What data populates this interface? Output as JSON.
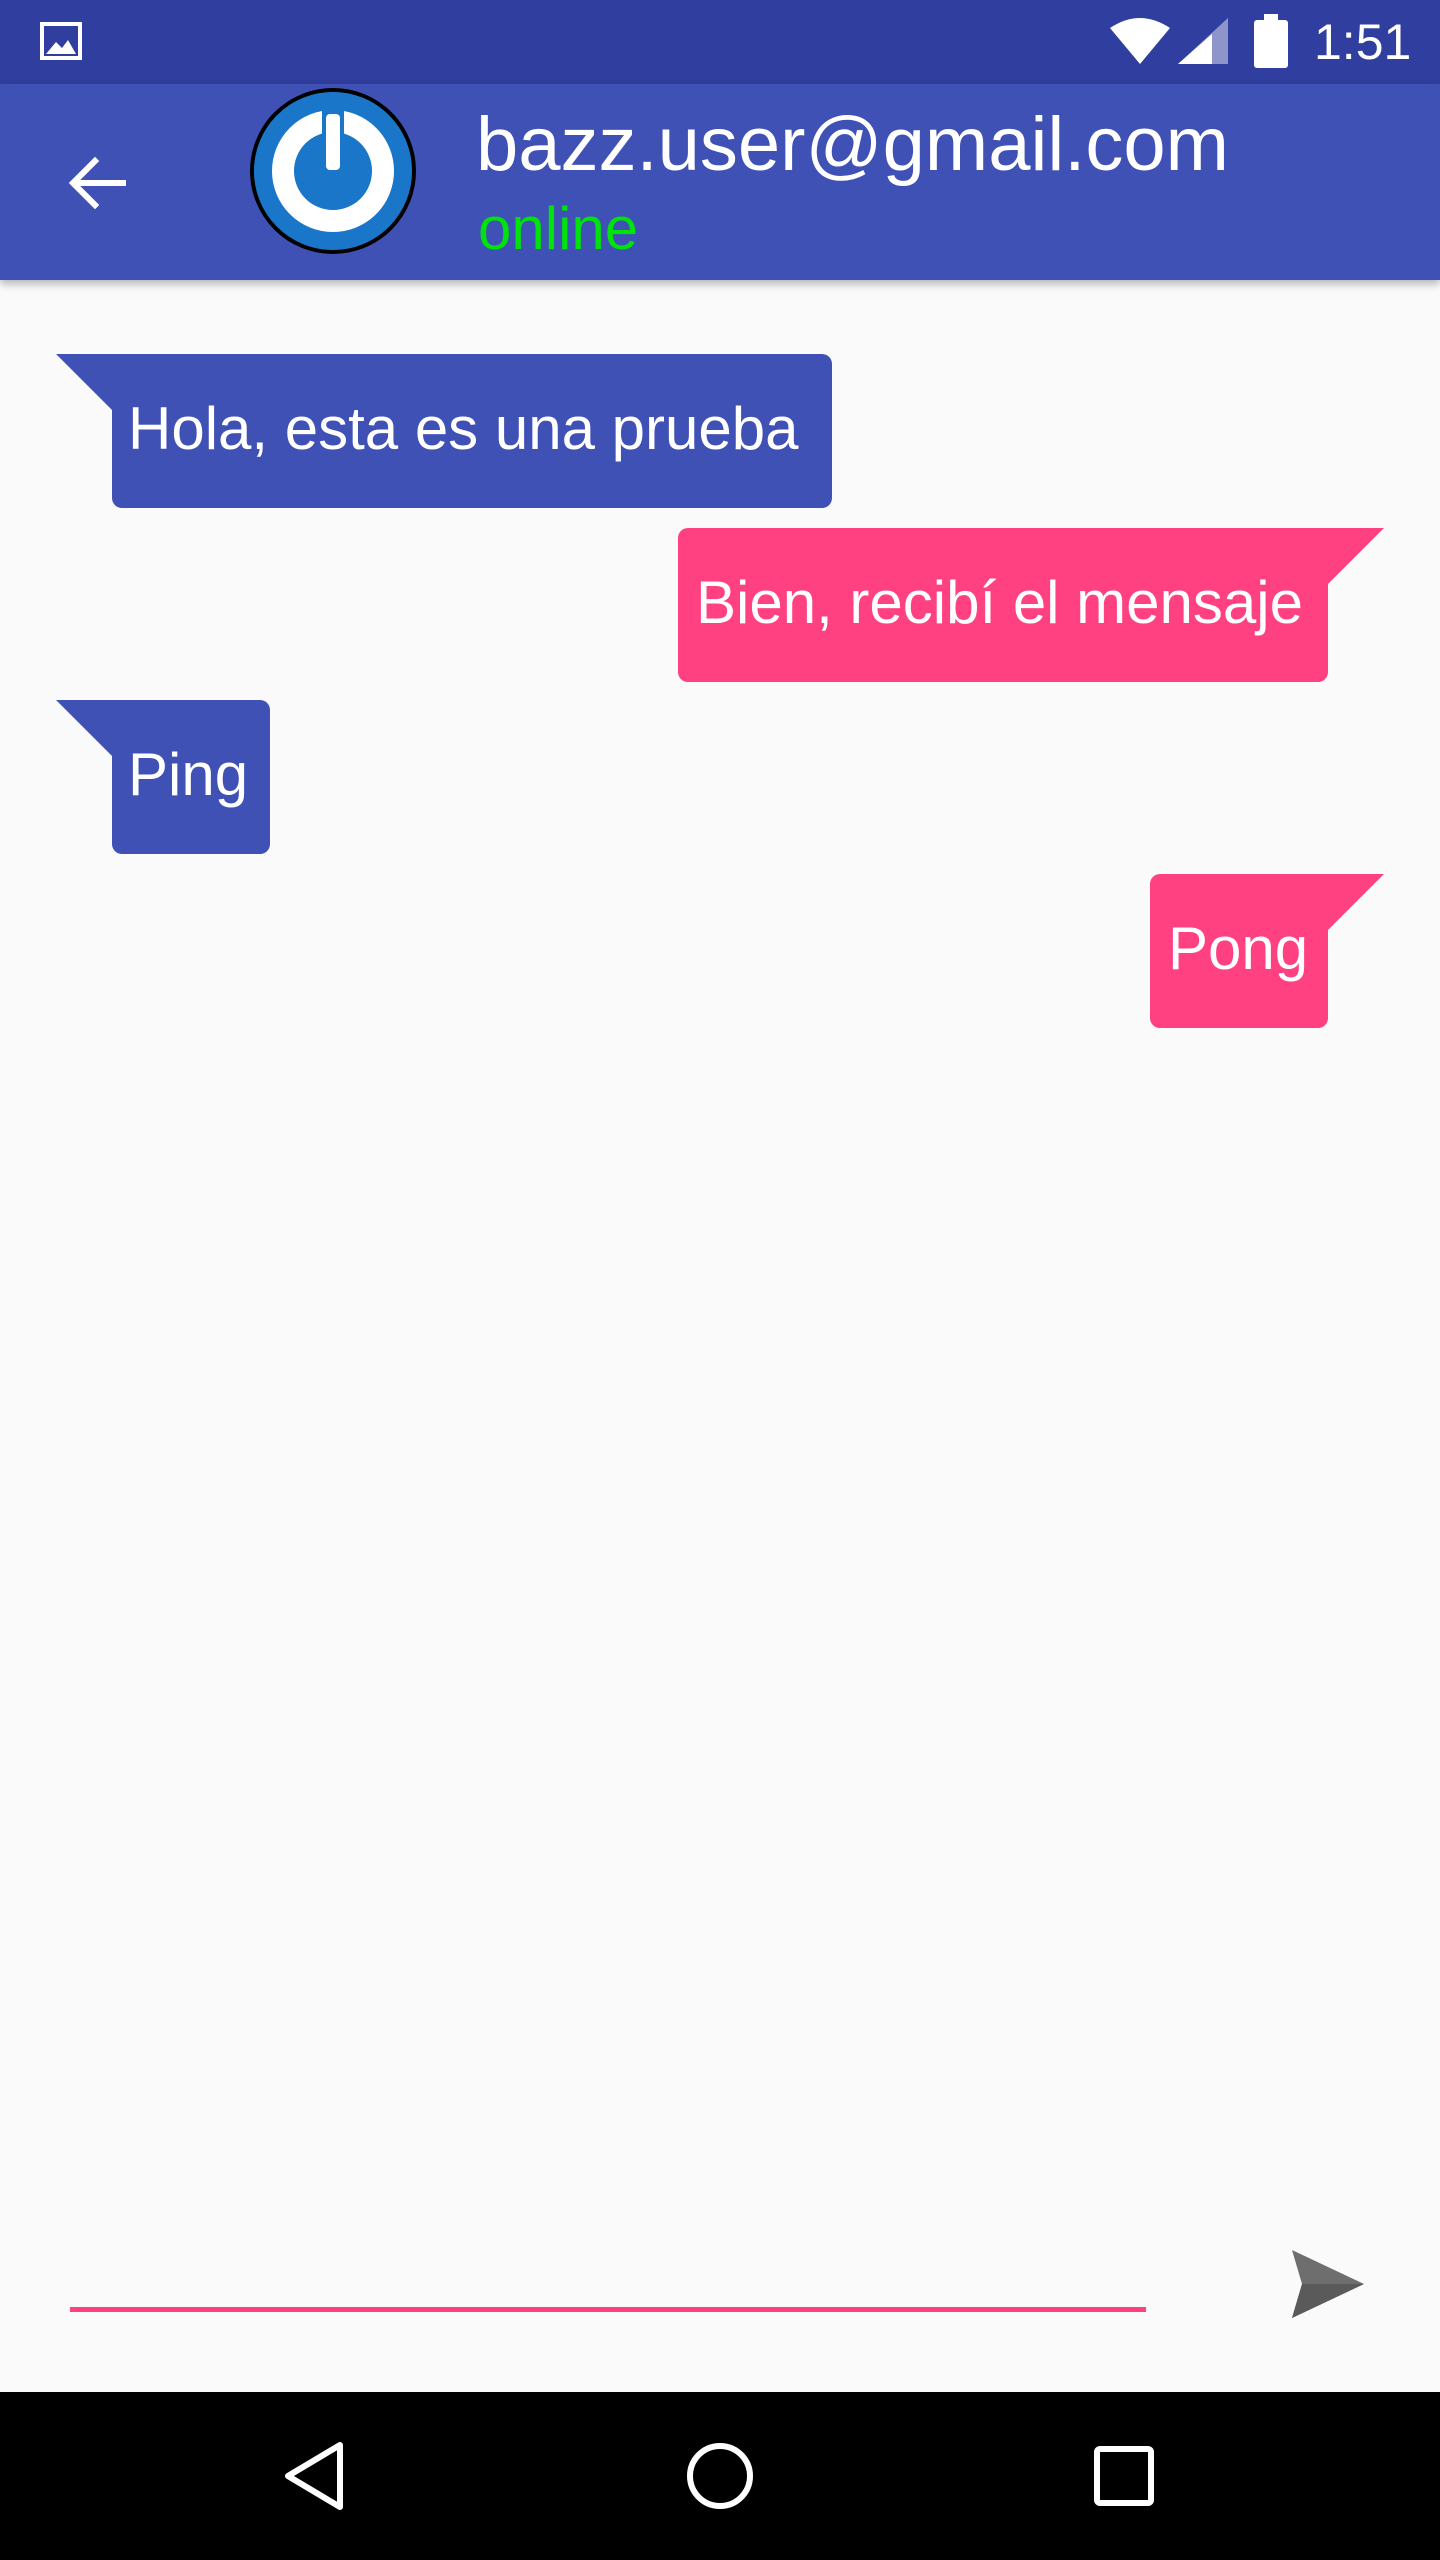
{
  "status_bar": {
    "time": "1:51",
    "icons": [
      "gallery-icon",
      "wifi-icon",
      "signal-icon",
      "battery-icon"
    ]
  },
  "header": {
    "contact_name": "bazz.user@gmail.com",
    "status": "online",
    "colors": {
      "bar": "#3f51b5",
      "status_bar": "#303f9f",
      "online": "#00e20c"
    },
    "icons": {
      "back": "arrow-left-icon",
      "avatar": "power-icon"
    }
  },
  "messages": [
    {
      "text": "Hola, esta es una prueba",
      "direction": "incoming"
    },
    {
      "text": "Bien, recibí el mensaje",
      "direction": "outgoing"
    },
    {
      "text": "Ping",
      "direction": "incoming"
    },
    {
      "text": "Pong",
      "direction": "outgoing"
    }
  ],
  "bubble_colors": {
    "incoming": "#3f51b5",
    "outgoing": "#ff4081"
  },
  "composer": {
    "value": "",
    "placeholder": "",
    "send_icon": "send-icon"
  },
  "nav_bar": {
    "buttons": [
      "back-triangle-icon",
      "home-circle-icon",
      "recents-square-icon"
    ]
  }
}
